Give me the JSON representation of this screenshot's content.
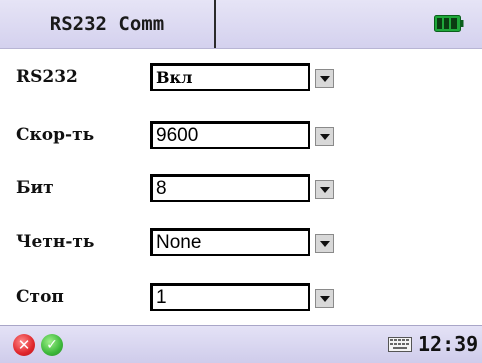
{
  "header": {
    "title": "RS232 Comm",
    "battery_icon": "battery-full-icon"
  },
  "form": {
    "rows": [
      {
        "label": "RS232",
        "value": "Вкл",
        "style": "serif"
      },
      {
        "label": "Скор-ть",
        "value": "9600",
        "style": "sans"
      },
      {
        "label": "Бит",
        "value": "8",
        "style": "sans"
      },
      {
        "label": "Четн-ть",
        "value": "None",
        "style": "sans"
      },
      {
        "label": "Стоп",
        "value": "1",
        "style": "sans"
      }
    ]
  },
  "footer": {
    "cancel_icon": "cancel-icon",
    "cancel_glyph": "✕",
    "ok_icon": "ok-icon",
    "ok_glyph": "✓",
    "keyboard_icon": "keyboard-icon",
    "time": "12:39"
  },
  "colors": {
    "bar_bg": "#dcd9f2",
    "battery": "#1fa83a",
    "cancel": "#e0262b",
    "ok": "#3cb83a"
  }
}
